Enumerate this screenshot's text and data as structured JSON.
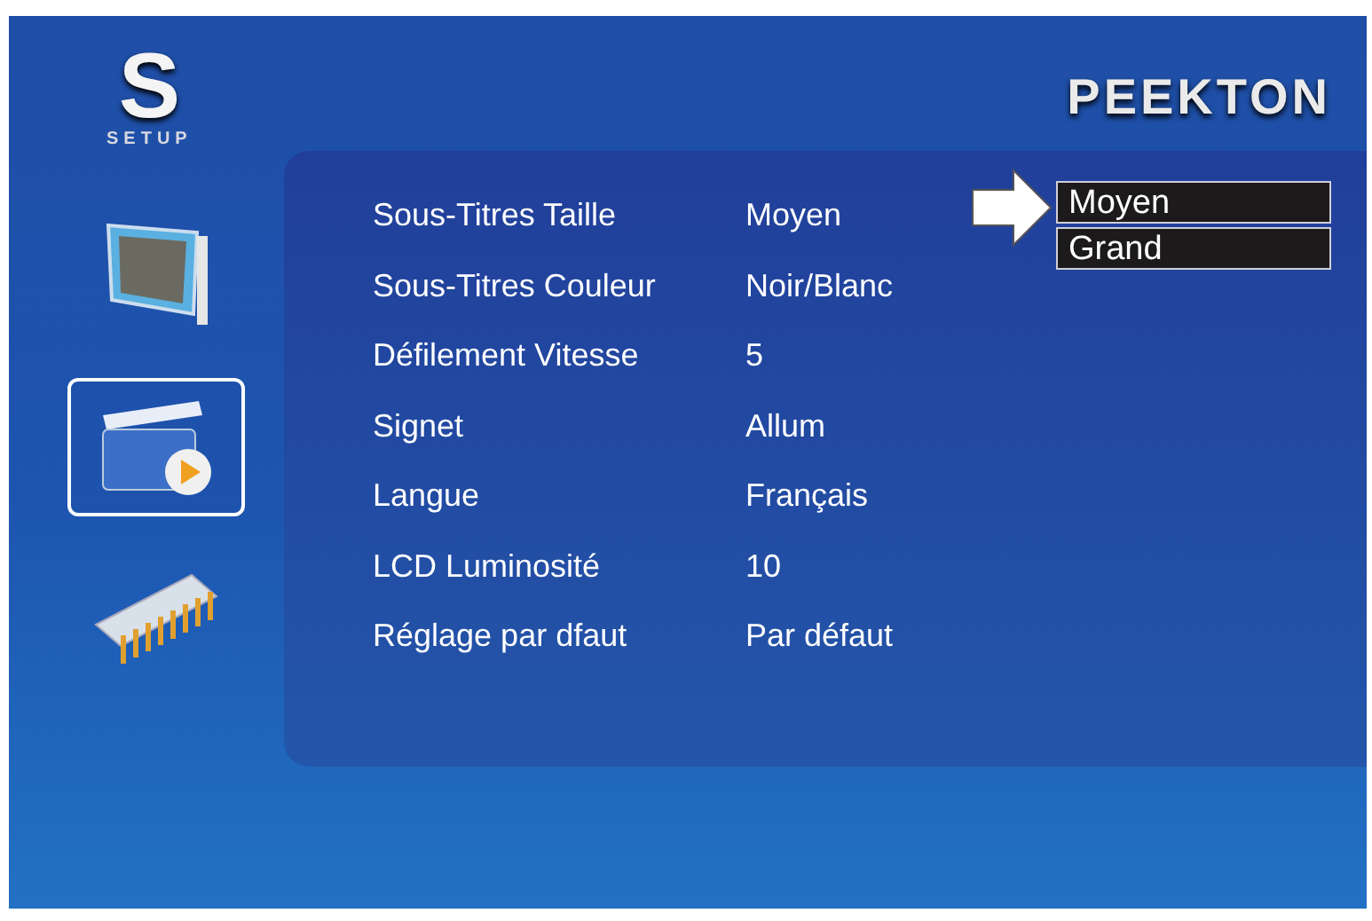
{
  "logo": {
    "letter": "S",
    "caption": "SETUP"
  },
  "brand": "PEEKTON",
  "sidebar": {
    "items": [
      {
        "kind": "display",
        "selected": false
      },
      {
        "kind": "video",
        "selected": true
      },
      {
        "kind": "system",
        "selected": false
      }
    ]
  },
  "settings": [
    {
      "label": "Sous-Titres Taille",
      "value": "Moyen"
    },
    {
      "label": "Sous-Titres Couleur",
      "value": "Noir/Blanc"
    },
    {
      "label": "Défilement Vitesse",
      "value": "5"
    },
    {
      "label": "Signet",
      "value": "Allum"
    },
    {
      "label": "Langue",
      "value": "Français"
    },
    {
      "label": "LCD Luminosité",
      "value": "10"
    },
    {
      "label": "Réglage par dfaut",
      "value": "Par défaut"
    }
  ],
  "dropdown": {
    "options": [
      "Moyen",
      "Grand"
    ]
  }
}
